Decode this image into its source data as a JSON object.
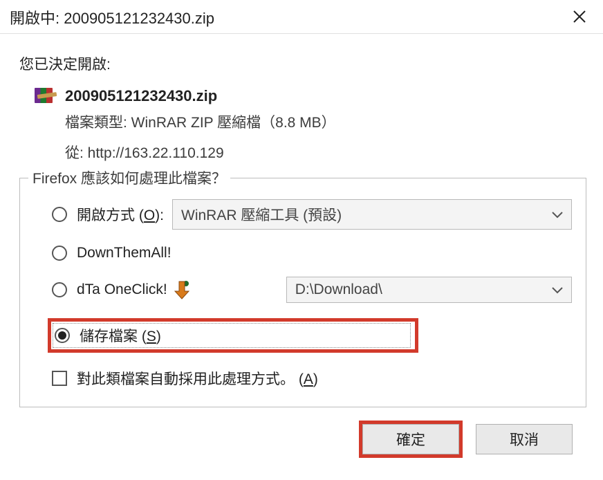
{
  "titlebar": {
    "prefix": "開啟中: ",
    "filename": "200905121232430.zip"
  },
  "decided_label": "您已決定開啟:",
  "file": {
    "name": "200905121232430.zip",
    "type_label": "檔案類型: ",
    "type_value": "WinRAR ZIP 壓縮檔（8.8 MB）",
    "from_label": "從: ",
    "from_value": "http://163.22.110.129"
  },
  "group": {
    "legend": "Firefox 應該如何處理此檔案？",
    "open_with": {
      "label_pre": "開啟方式 (",
      "label_u": "O",
      "label_post": "):",
      "select_text": "WinRAR 壓縮工具 (預設)"
    },
    "dta_all": {
      "label": "DownThemAll!"
    },
    "dta_oneclick": {
      "label": "dTa OneClick!",
      "dest": "D:\\Download\\"
    },
    "save_file": {
      "label_pre": "儲存檔案 (",
      "label_u": "S",
      "label_post": ")"
    },
    "remember": {
      "label_pre": "對此類檔案自動採用此處理方式。 (",
      "label_u": "A",
      "label_post": ")"
    }
  },
  "buttons": {
    "ok": "確定",
    "cancel": "取消"
  }
}
